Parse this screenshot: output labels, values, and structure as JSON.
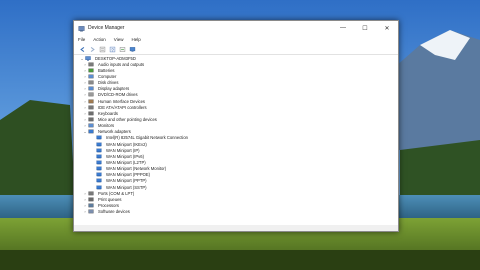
{
  "window": {
    "title": "Device Manager",
    "minimize": "—",
    "maximize": "☐",
    "close": "✕"
  },
  "menu": [
    "File",
    "Action",
    "View",
    "Help"
  ],
  "toolbar": [
    "back-icon",
    "forward-icon",
    "properties-icon",
    "help-icon",
    "update-driver-icon",
    "monitor-icon"
  ],
  "tree": {
    "root": "DESKTOP-ADM3F5D",
    "categories": [
      {
        "label": "Audio inputs and outputs",
        "icon": "speaker-icon"
      },
      {
        "label": "Batteries",
        "icon": "battery-icon"
      },
      {
        "label": "Computer",
        "icon": "computer-icon"
      },
      {
        "label": "Disk drives",
        "icon": "disk-icon"
      },
      {
        "label": "Display adapters",
        "icon": "display-icon"
      },
      {
        "label": "DVD/CD-ROM drives",
        "icon": "dvd-icon"
      },
      {
        "label": "Human Interface Devices",
        "icon": "hid-icon"
      },
      {
        "label": "IDE ATA/ATAPI controllers",
        "icon": "ide-icon"
      },
      {
        "label": "Keyboards",
        "icon": "keyboard-icon"
      },
      {
        "label": "Mice and other pointing devices",
        "icon": "mouse-icon"
      },
      {
        "label": "Monitors",
        "icon": "monitor-icon"
      },
      {
        "label": "Network adapters",
        "icon": "network-icon",
        "expanded": true
      }
    ],
    "network_children": [
      "Intel(R) 82574L Gigabit Network Connection",
      "WAN Miniport (IKEv2)",
      "WAN Miniport (IP)",
      "WAN Miniport (IPv6)",
      "WAN Miniport (L2TP)",
      "WAN Miniport (Network Monitor)",
      "WAN Miniport (PPPOE)",
      "WAN Miniport (PPTP)",
      "WAN Miniport (SSTP)"
    ],
    "more_categories": [
      {
        "label": "Ports (COM & LPT)",
        "icon": "port-icon"
      },
      {
        "label": "Print queues",
        "icon": "printer-icon"
      },
      {
        "label": "Processors",
        "icon": "processor-icon"
      },
      {
        "label": "Software devices",
        "icon": "software-icon"
      }
    ]
  },
  "colors": {
    "accent": "#1e78d7",
    "selection": "#cce8ff",
    "sky": "#4a8fd6",
    "lake": "#3f7fa8",
    "grass": "#6c8f2b"
  }
}
